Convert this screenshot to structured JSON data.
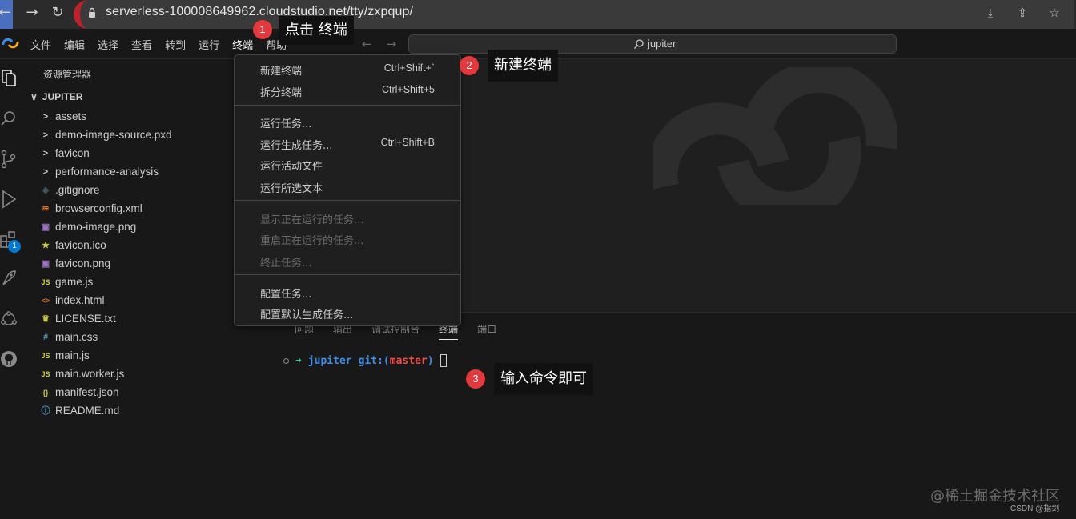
{
  "browser": {
    "url": "serverless-100008649962.cloudstudio.net/tty/zxpqup/",
    "back_icon": "arrow-left-icon",
    "forward_icon": "arrow-right-icon",
    "reload_icon": "reload-icon"
  },
  "menubar": {
    "items": [
      "文件",
      "编辑",
      "选择",
      "查看",
      "转到",
      "运行",
      "终端",
      "帮助"
    ],
    "active_item": "终端",
    "command_center": "jupiter"
  },
  "activity_bar": {
    "icons": [
      "explorer-icon",
      "search-icon",
      "source-control-icon",
      "run-debug-icon",
      "extensions-icon",
      "remote-icon",
      "network-icon",
      "github-icon"
    ],
    "extensions_badge": "1"
  },
  "sidebar": {
    "title": "资源管理器",
    "folder": "JUPITER",
    "items": [
      {
        "name": "assets",
        "icon": "chevron-right-icon",
        "glyph": ">",
        "color": "#cccccc"
      },
      {
        "name": "demo-image-source.pxd",
        "icon": "chevron-right-icon",
        "glyph": ">",
        "color": "#cccccc"
      },
      {
        "name": "favicon",
        "icon": "chevron-right-icon",
        "glyph": ">",
        "color": "#cccccc"
      },
      {
        "name": "performance-analysis",
        "icon": "chevron-right-icon",
        "glyph": ">",
        "color": "#cccccc"
      },
      {
        "name": ".gitignore",
        "icon": "git-file-icon",
        "glyph": "◆",
        "color": "#41535b"
      },
      {
        "name": "browserconfig.xml",
        "icon": "rss-file-icon",
        "glyph": "≋",
        "color": "#e37933"
      },
      {
        "name": "demo-image.png",
        "icon": "image-file-icon",
        "glyph": "▣",
        "color": "#a074c4"
      },
      {
        "name": "favicon.ico",
        "icon": "star-file-icon",
        "glyph": "★",
        "color": "#cbcb41"
      },
      {
        "name": "favicon.png",
        "icon": "image-file-icon",
        "glyph": "▣",
        "color": "#a074c4"
      },
      {
        "name": "game.js",
        "icon": "js-file-icon",
        "glyph": "JS",
        "color": "#cbcb41"
      },
      {
        "name": "index.html",
        "icon": "html-file-icon",
        "glyph": "<>",
        "color": "#e37933"
      },
      {
        "name": "LICENSE.txt",
        "icon": "license-file-icon",
        "glyph": "♛",
        "color": "#cbcb41"
      },
      {
        "name": "main.css",
        "icon": "css-file-icon",
        "glyph": "#",
        "color": "#519aba"
      },
      {
        "name": "main.js",
        "icon": "js-file-icon",
        "glyph": "JS",
        "color": "#cbcb41"
      },
      {
        "name": "main.worker.js",
        "icon": "js-file-icon",
        "glyph": "JS",
        "color": "#cbcb41"
      },
      {
        "name": "manifest.json",
        "icon": "json-file-icon",
        "glyph": "{}",
        "color": "#cbcb41"
      },
      {
        "name": "README.md",
        "icon": "info-file-icon",
        "glyph": "ⓘ",
        "color": "#519aba"
      }
    ]
  },
  "terminal_menu": {
    "items": [
      {
        "label": "新建终端",
        "shortcut": "Ctrl+Shift+`",
        "disabled": false
      },
      {
        "label": "拆分终端",
        "shortcut": "Ctrl+Shift+5",
        "disabled": false
      },
      {
        "label": "运行任务...",
        "shortcut": "",
        "disabled": false
      },
      {
        "label": "运行生成任务...",
        "shortcut": "Ctrl+Shift+B",
        "disabled": false
      },
      {
        "label": "运行活动文件",
        "shortcut": "",
        "disabled": false
      },
      {
        "label": "运行所选文本",
        "shortcut": "",
        "disabled": false
      },
      {
        "label": "显示正在运行的任务...",
        "shortcut": "",
        "disabled": true
      },
      {
        "label": "重启正在运行的任务...",
        "shortcut": "",
        "disabled": true
      },
      {
        "label": "终止任务...",
        "shortcut": "",
        "disabled": true
      },
      {
        "label": "配置任务...",
        "shortcut": "",
        "disabled": false
      },
      {
        "label": "配置默认生成任务...",
        "shortcut": "",
        "disabled": false
      }
    ]
  },
  "panel": {
    "tabs": [
      "问题",
      "输出",
      "调试控制台",
      "终端",
      "端口"
    ],
    "active_tab": "终端",
    "prompt_dir": "jupiter",
    "prompt_git": "git:(",
    "prompt_branch": "master",
    "prompt_git_close": ")"
  },
  "annotations": [
    {
      "number": "1",
      "text": "点击 终端"
    },
    {
      "number": "2",
      "text": "新建终端"
    },
    {
      "number": "3",
      "text": "输入命令即可"
    }
  ],
  "watermark": {
    "main": "@稀土掘金技术社区",
    "sub": "CSDN @指剑"
  },
  "colors": {
    "accent": "#0078d4",
    "annotation_red": "#e4393c",
    "terminal_green": "#23d18b",
    "terminal_blue": "#3b8eea",
    "terminal_red": "#f14c4c"
  }
}
